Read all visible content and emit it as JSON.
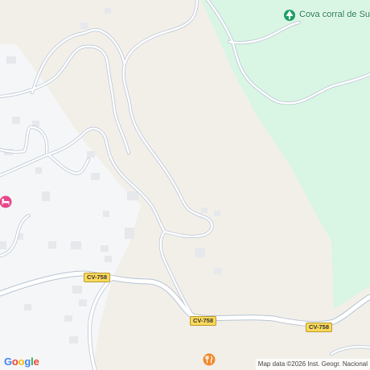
{
  "map": {
    "colors": {
      "land": "#f2efe9",
      "park": "#d9f5e3",
      "urban": "#f5f6f7",
      "building": "#e6e8ec",
      "road_fill": "#ffffff",
      "road_casing": "#b7c4d4",
      "shield_fill": "#fcd95b",
      "poi_park": "#1e9e64",
      "poi_food": "#f08a2c",
      "poi_lodging": "#e8458a"
    },
    "poi": {
      "name": "Cova corral de Suay",
      "icon": "tree-icon"
    },
    "road_labels": [
      "CV-758",
      "CV-758",
      "CV-758"
    ],
    "icons": {
      "restaurant": "fork-knife-icon",
      "lodging": "bed-icon"
    },
    "google_logo": {
      "letters": [
        "G",
        "o",
        "o",
        "g",
        "l",
        "e"
      ]
    },
    "attribution": "Map data ©2026 Inst. Geogr. Nacional"
  }
}
